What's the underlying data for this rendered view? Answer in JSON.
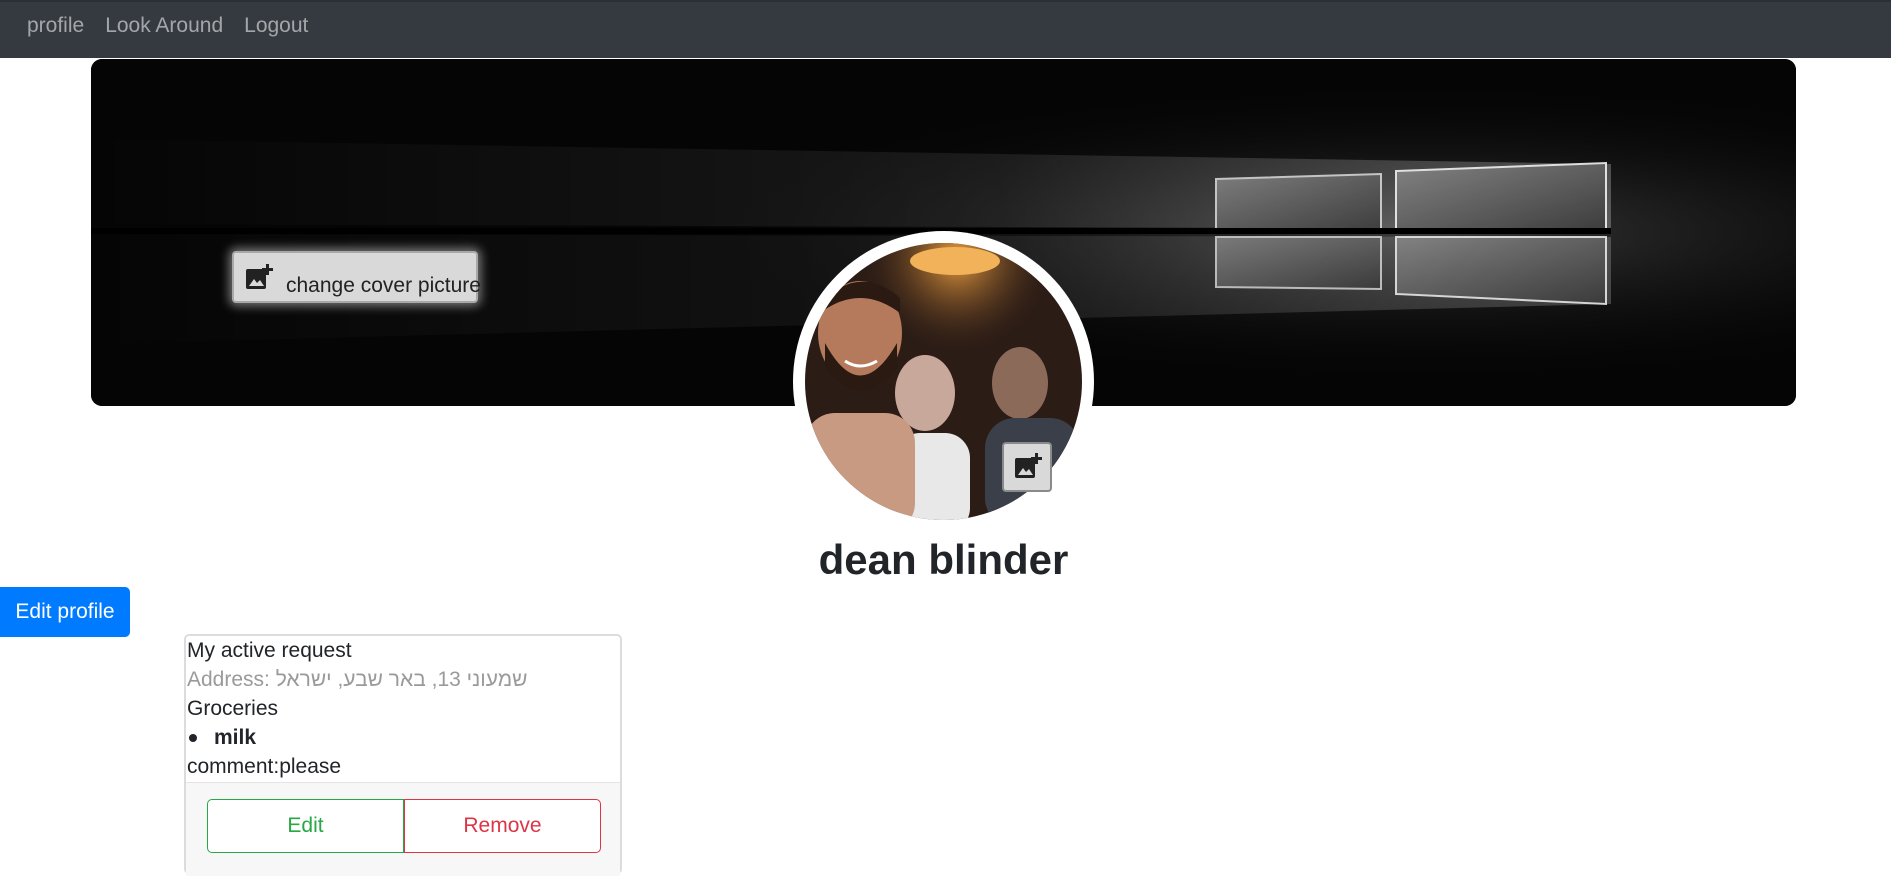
{
  "nav": {
    "items": [
      {
        "label": "profile"
      },
      {
        "label": "Look Around"
      },
      {
        "label": "Logout"
      }
    ]
  },
  "cover": {
    "change_cover_label": "change cover picture",
    "change_cover_icon": "add-photo-icon"
  },
  "avatar": {
    "change_avatar_icon": "add-photo-icon"
  },
  "profile": {
    "name": "dean blinder",
    "edit_label": "Edit profile"
  },
  "request": {
    "title": "My active request",
    "address_label": "Address:",
    "address_value": "שמעוני 13, באר שבע, ישראל",
    "category": "Groceries",
    "items": [
      "milk"
    ],
    "comment_label": "comment:",
    "comment_value": "please",
    "edit_label": "Edit",
    "remove_label": "Remove"
  },
  "colors": {
    "navbar_bg": "#343a40",
    "primary": "#007bff",
    "success": "#28a745",
    "danger": "#dc3545"
  }
}
